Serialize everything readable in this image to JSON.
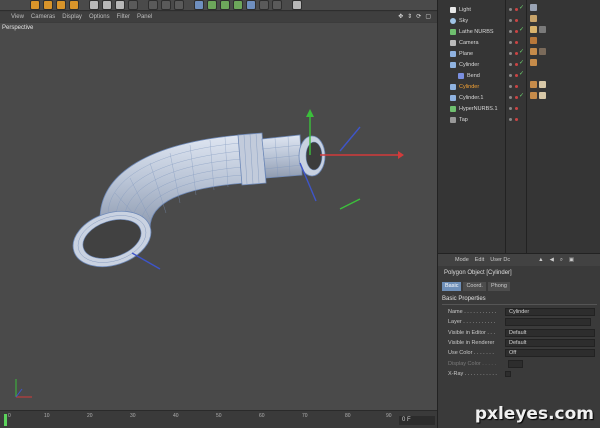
{
  "viewport": {
    "menu": [
      "View",
      "Cameras",
      "Display",
      "Options",
      "Filter",
      "Panel"
    ],
    "label": "Perspective"
  },
  "timeline": {
    "ticks": [
      "0",
      "10",
      "20",
      "30",
      "40",
      "50",
      "60",
      "70",
      "80",
      "90"
    ],
    "current_frame": "0 F"
  },
  "objects": [
    {
      "name": "Light",
      "selected": false
    },
    {
      "name": "Sky",
      "selected": false
    },
    {
      "name": "Lathe NURBS",
      "selected": false
    },
    {
      "name": "Camera",
      "selected": false
    },
    {
      "name": "Plane",
      "selected": false
    },
    {
      "name": "Cylinder",
      "selected": false
    },
    {
      "name": "Bend",
      "selected": false
    },
    {
      "name": "Cylinder",
      "selected": true
    },
    {
      "name": "Cylinder.1",
      "selected": false
    },
    {
      "name": "HyperNURBS.1",
      "selected": false
    },
    {
      "name": "Tap",
      "selected": false
    }
  ],
  "attributes": {
    "menu": [
      "Mode",
      "Edit",
      "User Dc"
    ],
    "title": "Polygon Object [Cylinder]",
    "tabs": [
      "Basic",
      "Coord.",
      "Phong"
    ],
    "section": "Basic Properties",
    "props": {
      "name_label": "Name . . . . . . . . . . .",
      "name_value": "Cylinder",
      "layer_label": "Layer . . . . . . . . . . .",
      "visible_editor_label": "Visible in Editor . . .",
      "visible_editor_value": "Default",
      "visible_renderer_label": "Visible in Renderer",
      "visible_renderer_value": "Default",
      "use_color_label": "Use Color . . . . . . .",
      "use_color_value": "Off",
      "display_color_label": "Display Color . . . . .",
      "xray_label": "X-Ray . . . . . . . . . . ."
    }
  },
  "watermark": "pxleyes.com"
}
